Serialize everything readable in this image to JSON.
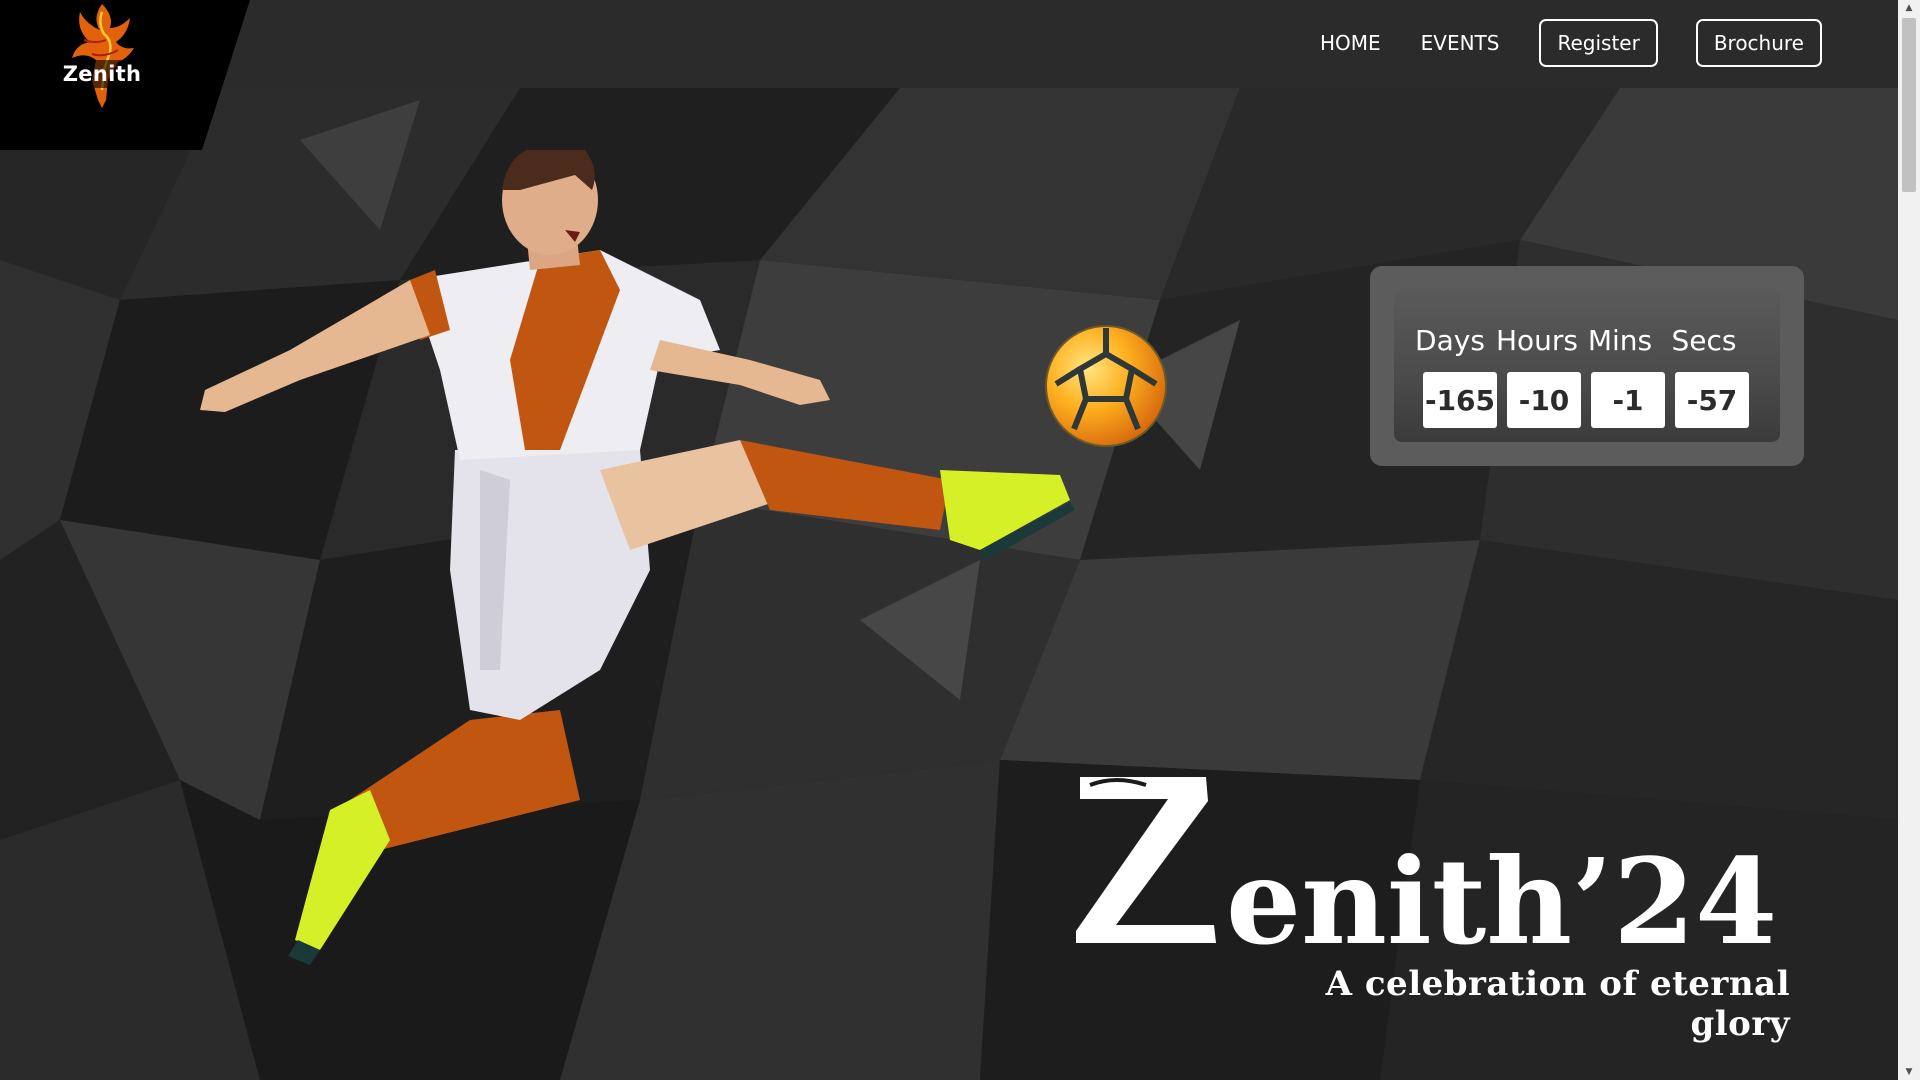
{
  "brand": {
    "name": "Zenith"
  },
  "nav": {
    "home": "HOME",
    "events": "EVENTS",
    "register": "Register",
    "brochure": "Brochure"
  },
  "countdown": {
    "labels": [
      "Days",
      "Hours",
      "Mins",
      "Secs"
    ],
    "values": [
      "-165",
      "-10",
      "-1",
      "-57"
    ]
  },
  "hero": {
    "title": "Zenith’24",
    "tagline": "A celebration of eternal glory"
  },
  "colors": {
    "nav_bg": "#2b2b2b",
    "page_bg": "#151515",
    "countdown_outer": "#5c5c5c",
    "jersey_accent": "#c0560f",
    "boot_color": "#d6f028"
  },
  "icons": {
    "logo": "phoenix-horse-icon",
    "player": "football-player-image",
    "ball": "football-icon"
  }
}
